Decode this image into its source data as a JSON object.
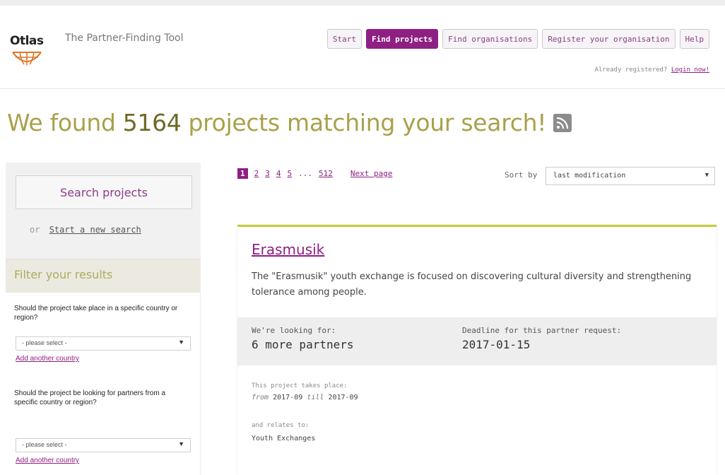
{
  "header": {
    "logo_text": "Otlas",
    "tagline": "The Partner-Finding Tool",
    "nav": [
      "Start",
      "Find projects",
      "Find organisations",
      "Register your organisation",
      "Help"
    ],
    "login_prompt": "Already registered?",
    "login_link": "Login now!"
  },
  "headline": {
    "pre": "We found",
    "count": "5164",
    "post": "projects matching your search!",
    "icon": "rss-icon"
  },
  "sidebar": {
    "search_button": "Search projects",
    "or_text": "or",
    "new_search_link": "Start a new search",
    "filter_title": "Filter your results",
    "q1": "Should the project take place in a specific country or region?",
    "q1_select": "- please select -",
    "q1_add": "Add another country",
    "q2": "Should the project be looking for partners from a specific country or region?",
    "q2_select": "- please select -",
    "q2_add": "Add another country"
  },
  "pager": {
    "pages": [
      "1",
      "2",
      "3",
      "4",
      "5"
    ],
    "ellipsis": "...",
    "last": "512",
    "next": "Next page"
  },
  "sort": {
    "label": "Sort by",
    "value": "last modification"
  },
  "project": {
    "title": "Erasmusik",
    "description": "The \"Erasmusik\" youth exchange is focused on discovering cultural diversity and strengthening tolerance among people.",
    "looking_label": "We're looking for:",
    "looking_value": "6 more partners",
    "deadline_label": "Deadline for this partner request:",
    "deadline_value": "2017-01-15",
    "takes_place_label": "This project takes place:",
    "from_word": "from",
    "from_date": "2017-09",
    "till_word": "till",
    "till_date": "2017-09",
    "relates_label": "and relates to:",
    "relates_value": "Youth Exchanges"
  },
  "colors": {
    "brand": "#8e1f83",
    "headline": "#a9a14a",
    "accent_line": "#c9cd3c"
  }
}
